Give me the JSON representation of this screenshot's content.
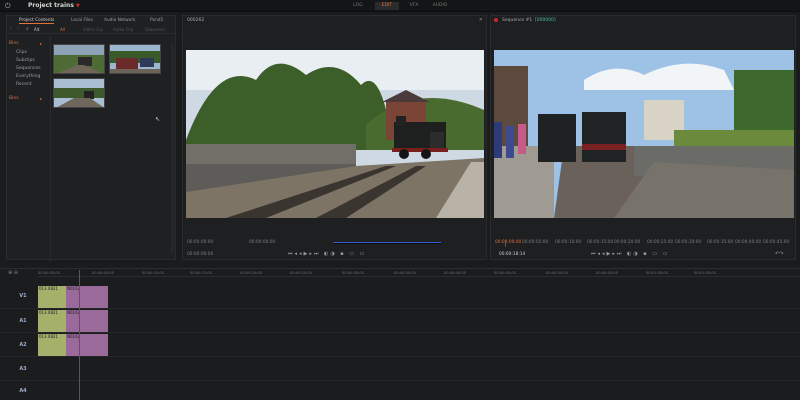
{
  "app": {
    "project_title": "Project trains",
    "modes": [
      {
        "label": "LOG",
        "active": false
      },
      {
        "label": "EDIT",
        "active": true
      },
      {
        "label": "VFX",
        "active": false
      },
      {
        "label": "AUDIO",
        "active": false
      }
    ]
  },
  "media_panel": {
    "tabs": [
      "Project Contents",
      "Local Files",
      "Audio Network",
      "Pond5"
    ],
    "active_tab": "Project Contents",
    "search_value": "Ait",
    "filter_tabs": [
      "All",
      "Video Clip",
      "Audio Clip",
      "Sequence"
    ],
    "sidebar": [
      {
        "label": "Bins",
        "category": true
      },
      {
        "label": "Clips",
        "category": false
      },
      {
        "label": "Subclips",
        "category": false
      },
      {
        "label": "Sequences",
        "category": false
      },
      {
        "label": "Everything",
        "category": false
      },
      {
        "label": "Recent",
        "category": false
      },
      {
        "label": "Bins",
        "category": true
      }
    ]
  },
  "source_viewer": {
    "title": "000262",
    "timecodes": [
      "00:00:00:00",
      "00:00:00:00"
    ],
    "current": "00:00:00:00"
  },
  "record_viewer": {
    "title": "Sequence #1",
    "subtitle": "[000000]",
    "timecodes": [
      "00:00:00:00",
      "00:00:05:00",
      "00:00:10:00",
      "00:00:15:00",
      "00:00:20:00",
      "00:00:25:00",
      "00:00:30:00",
      "00:00:35:00",
      "00:00:40:00",
      "00:00:45:00",
      "00:00:50:00"
    ],
    "current": "00:00:18:14"
  },
  "timeline": {
    "ruler": [
      "00:00:00:00",
      "00:00:05:00",
      "00:00:10:00",
      "00:00:15:00",
      "00:00:20:00",
      "00:00:25:00",
      "00:00:30:00",
      "00:00:35:00",
      "00:00:40:00",
      "00:00:45:00",
      "00:00:50:00",
      "00:00:55:00",
      "00:01:00:00",
      "00:01:05:00"
    ],
    "tracks": [
      "V1",
      "A1",
      "A2",
      "A3",
      "A4"
    ],
    "clip_label_1": "013 0821",
    "clip_label_2": "N0162"
  },
  "colors": {
    "accent": "#e3733d",
    "playhead": "#c52a2a",
    "clip_green": "#a5b06a",
    "clip_purple": "#9a6a9a"
  }
}
